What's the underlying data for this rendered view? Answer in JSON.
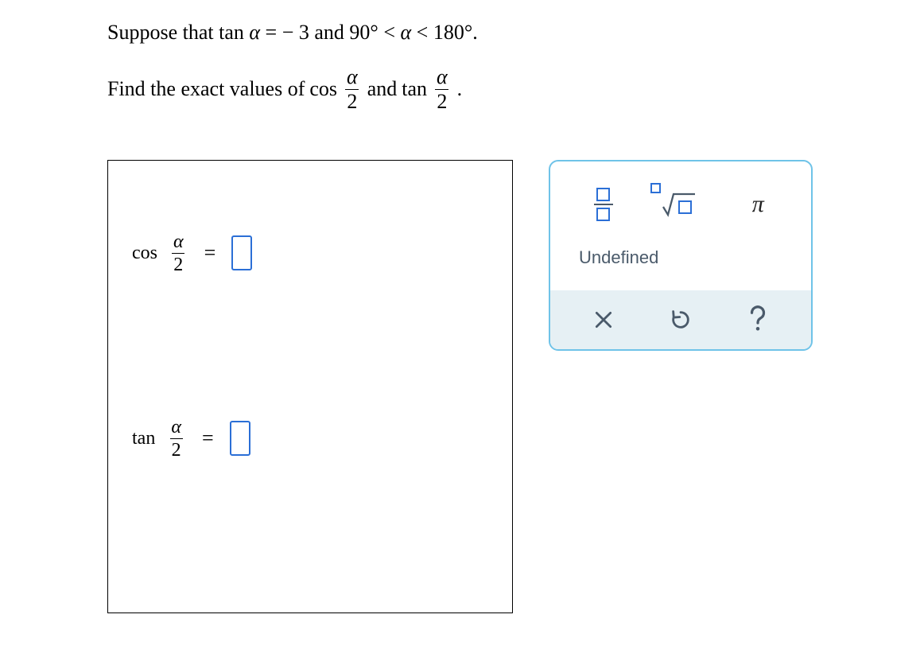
{
  "problem": {
    "line1_pre": "Suppose that ",
    "line1_tan": "tan",
    "line1_alpha": "α",
    "line1_eq": " = ",
    "line1_rhs": "− 3",
    "line1_mid": " and ",
    "line1_rng_l": "90°",
    "line1_lt1": "<",
    "line1_rng_m": "α",
    "line1_lt2": "<",
    "line1_rng_r": "180°",
    "line1_end": ".",
    "line2_pre": "Find the exact values of ",
    "line2_cos": "cos",
    "line2_frac_num": "α",
    "line2_frac_den": "2",
    "line2_and": " and ",
    "line2_tan": "tan",
    "line2_end": "."
  },
  "answers": {
    "cos_label": "cos",
    "cos_num": "α",
    "cos_den": "2",
    "eq": "=",
    "tan_label": "tan",
    "tan_num": "α",
    "tan_den": "2",
    "cos_value": "",
    "tan_value": ""
  },
  "palette": {
    "undefined_label": "Undefined",
    "pi": "π"
  }
}
